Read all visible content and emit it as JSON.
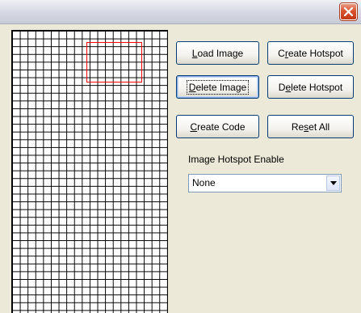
{
  "titlebar": {
    "close_icon": "close-icon"
  },
  "buttons": {
    "load_image": {
      "pre": "",
      "key": "L",
      "post": "oad Image"
    },
    "create_hotspot": {
      "pre": "C",
      "key": "r",
      "post": "eate Hotspot"
    },
    "delete_image": {
      "pre": "",
      "key": "D",
      "post": "elete Image"
    },
    "delete_hotspot": {
      "pre": "D",
      "key": "e",
      "post": "lete Hotspot"
    },
    "create_code": {
      "pre": "",
      "key": "C",
      "post": "reate Code"
    },
    "reset_all": {
      "pre": "Re",
      "key": "s",
      "post": "et All"
    }
  },
  "hotspot": {
    "label": "Image Hotspot Enable",
    "selected": "None"
  },
  "colors": {
    "hotspot_outline": "#ff0000",
    "grid_line": "#000000",
    "window_bg": "#ECE9D8"
  }
}
